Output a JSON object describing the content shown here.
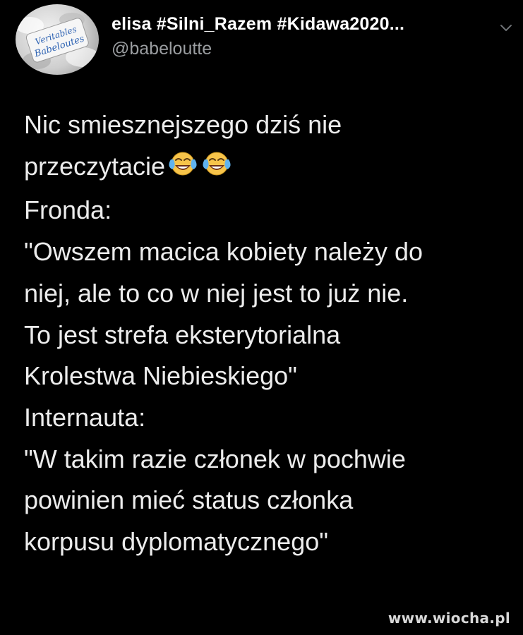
{
  "author": {
    "display_name": "elisa #Silni_Razem #Kidawa2020...",
    "handle": "@babeloutte",
    "avatar_text": "Veritables Babeloutes",
    "avatar_icon": "candy-avatar-icon",
    "menu_icon": "chevron-down-icon"
  },
  "tweet": {
    "lines": [
      "Nic smiesznejszego dziś nie",
      "przeczytacie",
      "Fronda:",
      "\"Owszem macica kobiety należy do",
      "niej, ale to co w niej jest to już nie.",
      "To jest strefa eksterytorialna",
      "Krolestwa Niebieskiego\"",
      "Internauta:",
      "\"W takim razie członek w pochwie",
      "powinien mieć status członka",
      "korpusu dyplomatycznego\""
    ],
    "emoji": [
      "face-with-tears-of-joy-icon",
      "face-with-tears-of-joy-icon"
    ]
  },
  "watermark": "www.wiocha.pl",
  "colors": {
    "background": "#000000",
    "text": "#e7e9ea",
    "secondary": "#9a9da0",
    "emoji_yellow": "#f7c44a",
    "emoji_tear": "#5fb3f0"
  }
}
